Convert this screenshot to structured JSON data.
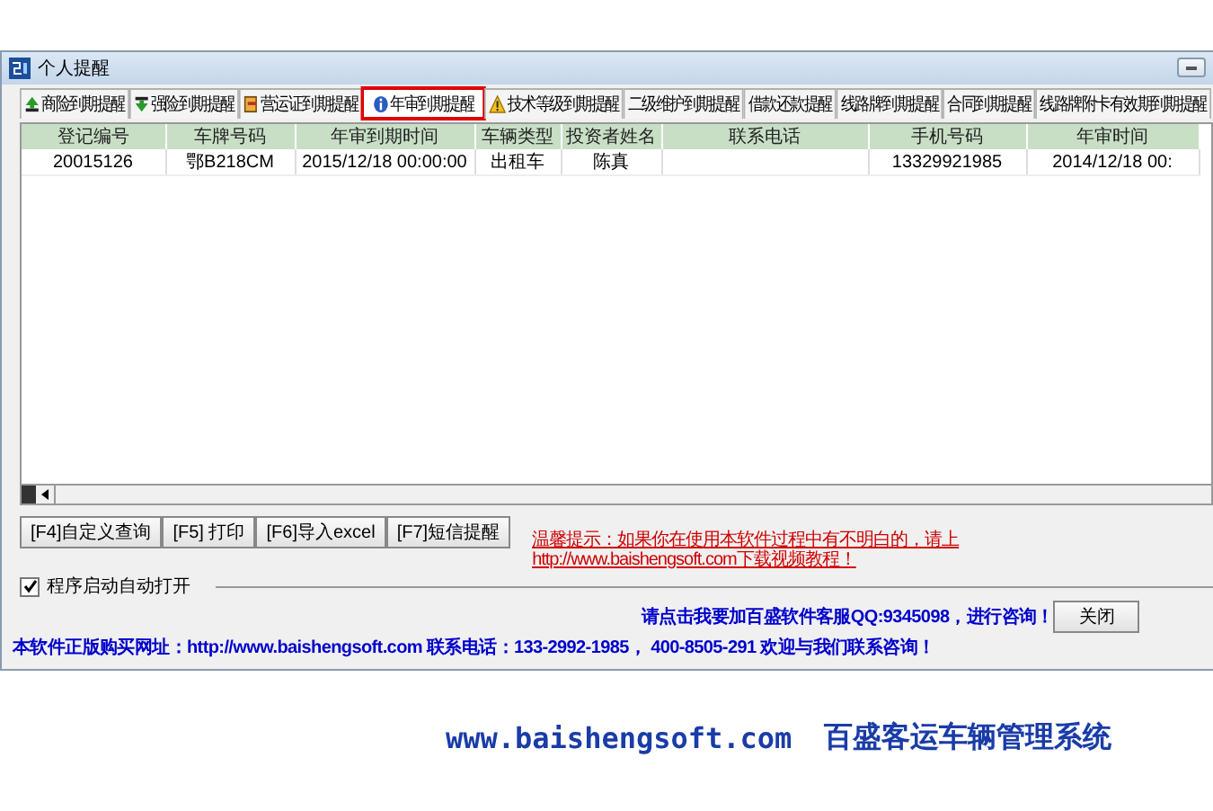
{
  "window": {
    "title": "个人提醒"
  },
  "tabs": [
    {
      "label": "商险到期提醒",
      "kind": "up",
      "selected": false
    },
    {
      "label": "强险到期提醒",
      "kind": "down",
      "selected": false
    },
    {
      "label": "营运证到期提醒",
      "kind": "card",
      "selected": false
    },
    {
      "label": "年审到期提醒",
      "kind": "info",
      "selected": true
    },
    {
      "label": "技术等级到期提醒",
      "kind": "warning",
      "selected": false
    },
    {
      "label": "二级维护到期提醒",
      "selected": false
    },
    {
      "label": "借款还款提醒",
      "selected": false
    },
    {
      "label": "线路牌到期提醒",
      "selected": false
    },
    {
      "label": "合同到期提醒",
      "selected": false
    },
    {
      "label": "线路牌附卡有效期到期提醒",
      "selected": false
    }
  ],
  "table": {
    "columns": [
      "登记编号",
      "车牌号码",
      "年审到期时间",
      "车辆类型",
      "投资者姓名",
      "联系电话",
      "手机号码",
      "年审时间"
    ],
    "rows": [
      [
        "20015126",
        "鄂B218CM",
        "2015/12/18 00:00:00",
        "出租车",
        "陈真",
        "",
        "13329921985",
        "2014/12/18 00:"
      ]
    ]
  },
  "buttons": [
    "[F4]自定义查询",
    "[F5] 打印",
    "[F6]导入excel",
    "[F7]短信提醒"
  ],
  "hint": "温馨提示：如果你在使用本软件过程中有不明白的，请上http://www.baishengsoft.com下载视频教程！",
  "autostart": {
    "label": "程序启动自动打开",
    "checked": true
  },
  "qq_link": "请点击我要加百盛软件客服QQ:9345098，进行咨询！",
  "close_button": "关闭",
  "purchase_link": "本软件正版购买网址：http://www.baishengsoft.com  联系电话：133-2992-1985， 400-8505-291 欢迎与我们联系咨询！",
  "caption": {
    "url": "www.baishengsoft.com",
    "product": "百盛客运车辆管理系统"
  }
}
